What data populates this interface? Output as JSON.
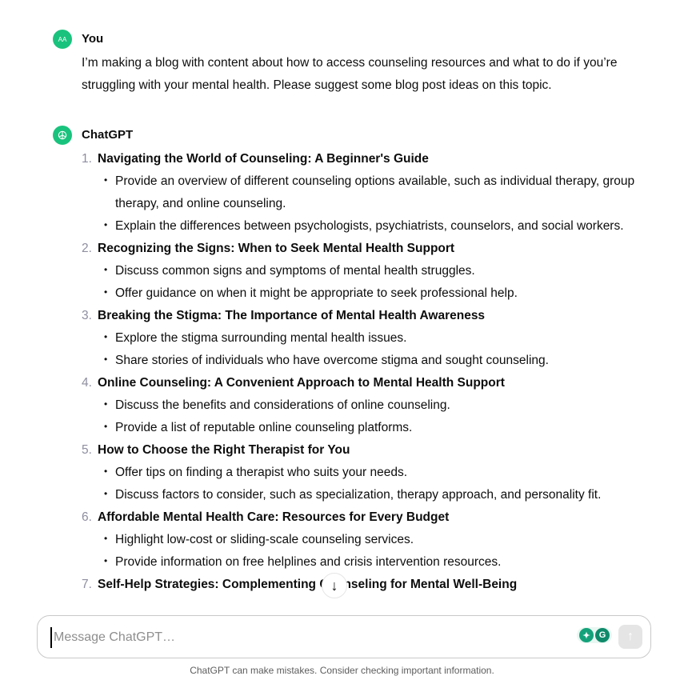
{
  "user_message": {
    "avatar_initials": "AA",
    "author": "You",
    "text": "I’m making a blog with content about how to access counseling resources and what to do if you’re struggling with your mental health. Please suggest some blog post ideas on this topic."
  },
  "assistant_message": {
    "author": "ChatGPT",
    "avatar_icon": "openai-logo-icon",
    "items": [
      {
        "num": "1.",
        "title": "Navigating the World of Counseling: A Beginner's Guide",
        "points": [
          "Provide an overview of different counseling options available, such as individual therapy, group therapy, and online counseling.",
          "Explain the differences between psychologists, psychiatrists, counselors, and social workers."
        ]
      },
      {
        "num": "2.",
        "title": "Recognizing the Signs: When to Seek Mental Health Support",
        "points": [
          "Discuss common signs and symptoms of mental health struggles.",
          "Offer guidance on when it might be appropriate to seek professional help."
        ]
      },
      {
        "num": "3.",
        "title": "Breaking the Stigma: The Importance of Mental Health Awareness",
        "points": [
          "Explore the stigma surrounding mental health issues.",
          "Share stories of individuals who have overcome stigma and sought counseling."
        ]
      },
      {
        "num": "4.",
        "title": "Online Counseling: A Convenient Approach to Mental Health Support",
        "points": [
          "Discuss the benefits and considerations of online counseling.",
          "Provide a list of reputable online counseling platforms."
        ]
      },
      {
        "num": "5.",
        "title": "How to Choose the Right Therapist for You",
        "points": [
          "Offer tips on finding a therapist who suits your needs.",
          "Discuss factors to consider, such as specialization, therapy approach, and personality fit."
        ]
      },
      {
        "num": "6.",
        "title": "Affordable Mental Health Care: Resources for Every Budget",
        "points": [
          "Highlight low-cost or sliding-scale counseling services.",
          "Provide information on free helplines and crisis intervention resources."
        ]
      },
      {
        "num": "7.",
        "title": "Self-Help Strategies: Complementing Counseling for Mental Well-Being",
        "points": []
      }
    ]
  },
  "composer": {
    "placeholder": "Message ChatGPT…",
    "value": "",
    "send_icon": "arrow-up-icon",
    "extensions": [
      "lightbulb-icon",
      "grammarly-icon"
    ]
  },
  "scroll_down_icon": "arrow-down-icon",
  "disclaimer": "ChatGPT can make mistakes. Consider checking important information.",
  "colors": {
    "avatar": "#19c37d",
    "accent": "#10a37f"
  }
}
